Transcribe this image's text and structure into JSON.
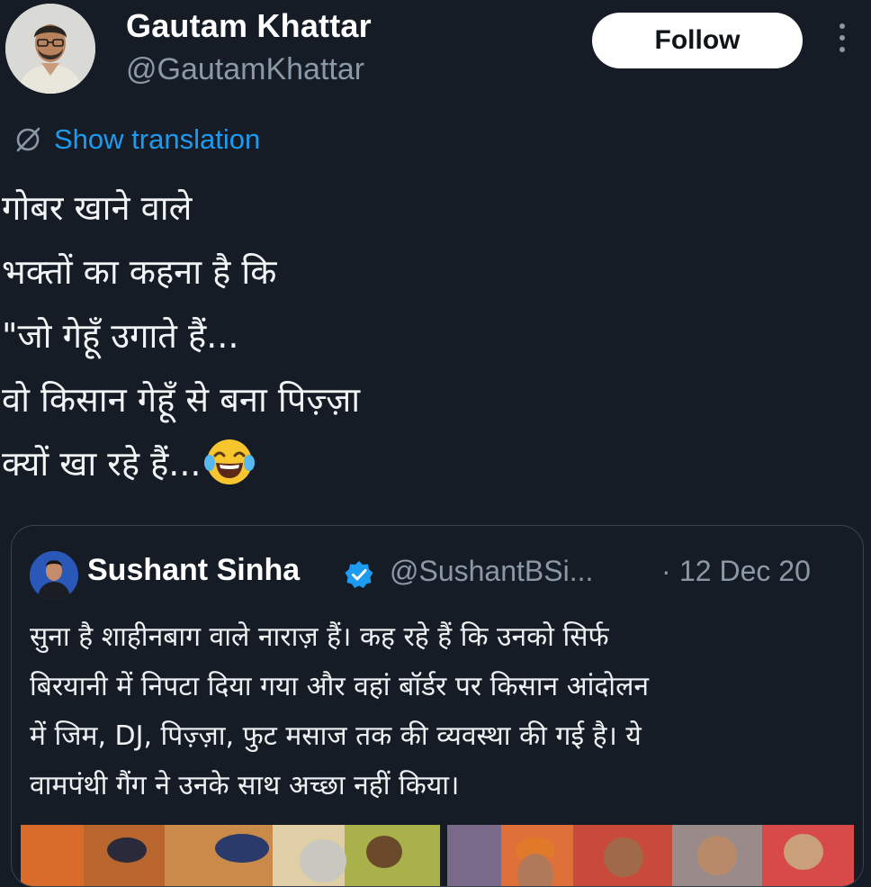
{
  "author": {
    "display_name": "Gautam Khattar",
    "handle": "@GautamKhattar"
  },
  "follow_label": "Follow",
  "translation_label": "Show translation",
  "tweet_lines": [
    "गोबर खाने वाले",
    "भक्तों का कहना है कि",
    "\"जो गेहूँ उगाते हैं...",
    "वो किसान गेहूँ से बना पिज़्ज़ा",
    "क्यों खा रहे हैं..."
  ],
  "tweet_emoji": "face-with-tears-of-joy-icon",
  "quote": {
    "display_name": "Sushant Sinha",
    "handle": "@SushantBSi...",
    "separator": "·",
    "date": "12 Dec 20",
    "lines": [
      "सुना है शाहीनबाग वाले नाराज़ हैं। कह रहे हैं कि उनको सिर्फ",
      "बिरयानी में निपटा दिया गया और वहां बॉर्डर पर किसान आंदोलन",
      "में जिम, DJ, पिज़्ज़ा, फुट मसाज तक की व्यवस्था की गई है। ये",
      "वामपंथी गैंग ने उनके साथ अच्छा नहीं किया।"
    ]
  },
  "colors": {
    "background": "#151c26",
    "link": "#1d9bf0",
    "verified": "#1d9bf0",
    "muted": "#8b98a5",
    "follow_button": "#ffffff"
  }
}
